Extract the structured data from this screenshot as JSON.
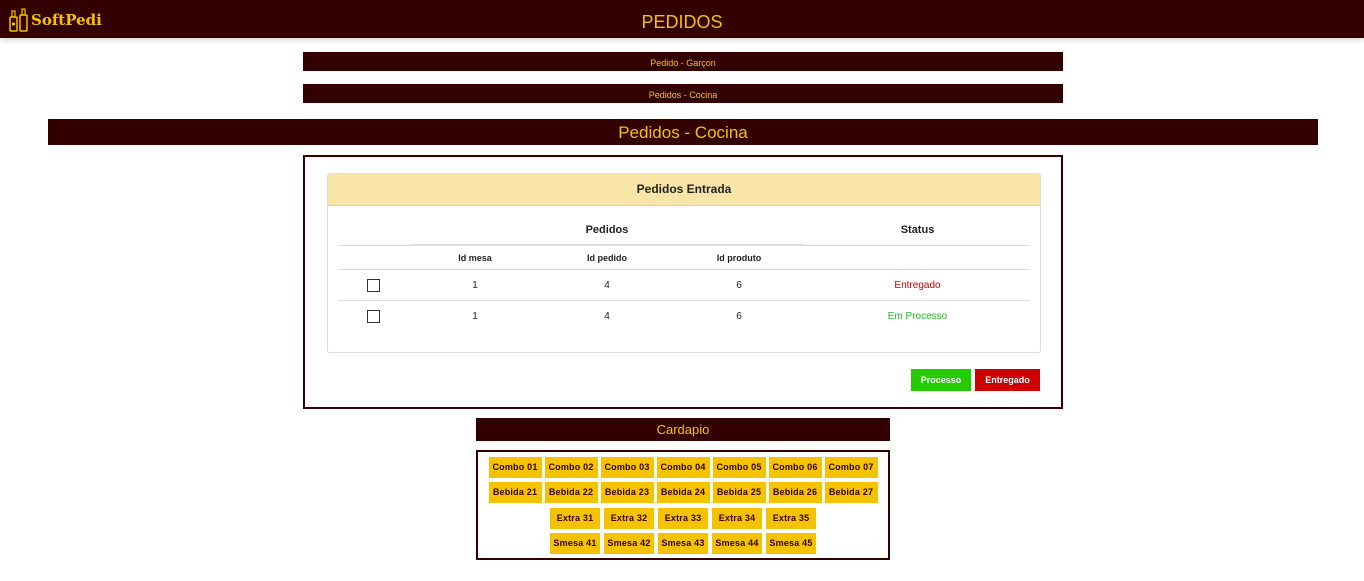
{
  "header": {
    "logo_text": "SoftPedi",
    "title": "PEDIDOS"
  },
  "nav": {
    "items": [
      {
        "label": "Pedido - Garçon"
      },
      {
        "label": "Pedidos - Cocina"
      }
    ]
  },
  "section": {
    "title": "Pedidos - Cocina"
  },
  "orders_panel": {
    "title": "Pedidos Entrada",
    "group_header_pedidos": "Pedidos",
    "group_header_status": "Status",
    "columns": [
      "Id mesa",
      "Id pedido",
      "Id produto"
    ],
    "rows": [
      {
        "id_mesa": "1",
        "id_pedido": "4",
        "id_produto": "6",
        "status": "Entregado",
        "checked": false
      },
      {
        "id_mesa": "1",
        "id_pedido": "4",
        "id_produto": "6",
        "status": "Em Processo",
        "checked": false
      }
    ],
    "buttons": {
      "processo": "Processo",
      "entregado": "Entregado"
    }
  },
  "cardapio": {
    "title": "Cardapio",
    "combos": [
      "Combo 01",
      "Combo 02",
      "Combo 03",
      "Combo 04",
      "Combo 05",
      "Combo 06",
      "Combo 07"
    ],
    "bebidas": [
      "Bebida 21",
      "Bebida 22",
      "Bebida 23",
      "Bebida 24",
      "Bebida 25",
      "Bebida 26",
      "Bebida 27"
    ],
    "extras": [
      "Extra 31",
      "Extra 32",
      "Extra 33",
      "Extra 34",
      "Extra 35"
    ],
    "smesas": [
      "Smesa 41",
      "Smesa 42",
      "Smesa 43",
      "Smesa 44",
      "Smesa 45"
    ]
  },
  "colors": {
    "dark_brown": "#330000",
    "gold": "#f5c200",
    "panel_header": "#f9e5a8",
    "status_delivered": "#cc0000",
    "status_processing": "#22bb22",
    "btn_processo": "#22cc00",
    "btn_entregado": "#cc0000"
  },
  "icons": {
    "logo": "bottles-logo-icon"
  }
}
